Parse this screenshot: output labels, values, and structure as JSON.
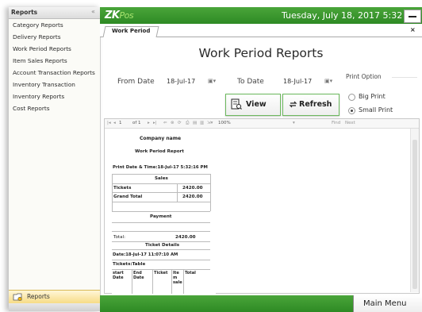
{
  "sidebar": {
    "title": "Reports",
    "collapse_glyph": "«",
    "items": [
      {
        "label": "Category Reports"
      },
      {
        "label": "Delivery Reports"
      },
      {
        "label": "Work Period Reports"
      },
      {
        "label": "Item Sales Reports"
      },
      {
        "label": "Account Transaction Reports"
      },
      {
        "label": "Inventory Transaction"
      },
      {
        "label": "Inventory Reports"
      },
      {
        "label": "Cost Reports"
      }
    ],
    "bottom_tab": {
      "label": "Reports",
      "icon": "reports-folder-icon"
    }
  },
  "header": {
    "logo_main": "ZK",
    "logo_sub": "Pos",
    "datetime": "Tuesday, July 18, 2017 5:32",
    "brand_color": "#3a9a2e"
  },
  "tabs": [
    {
      "label": "Work Period"
    }
  ],
  "tab_close": "×",
  "main": {
    "title": "Work Period Reports",
    "from_label": "From Date",
    "from_value": "18-Jul-17",
    "to_label": "To Date",
    "to_value": "18-Jul-17",
    "date_dropdown_glyph": "▣▾",
    "print_option_title": "Print Option",
    "print_options": [
      {
        "label": "Big Print",
        "selected": false
      },
      {
        "label": "Small Print",
        "selected": true
      }
    ],
    "view_label": "View",
    "refresh_label": "Refresh"
  },
  "viewer": {
    "toolbar": {
      "page": "1",
      "of": "of 1",
      "zoom": "100%",
      "find": "Find",
      "next": "Next"
    },
    "report": {
      "company": "Company name",
      "title": "Work Period Report",
      "print_dt": "Print Date & Time:18-Jul-17 5:32:16 PM",
      "sales_header": "Sales",
      "rows": [
        {
          "label": "Tickets",
          "value": "2420.00"
        },
        {
          "label": "Grand Total",
          "value": "2420.00"
        }
      ],
      "payment_header": "Payment",
      "total_label": "Total:",
      "total_value": "2420.00",
      "ticket_details": "Ticket Details",
      "date_line": "Date:18-Jul-17 11:07:10 AM",
      "tickets_table": "Tickets:Table",
      "cols": [
        "start Date",
        "End Date",
        "Ticket",
        "Ite m sale",
        "Total"
      ]
    }
  },
  "footer": {
    "main_menu": "Main Menu"
  }
}
